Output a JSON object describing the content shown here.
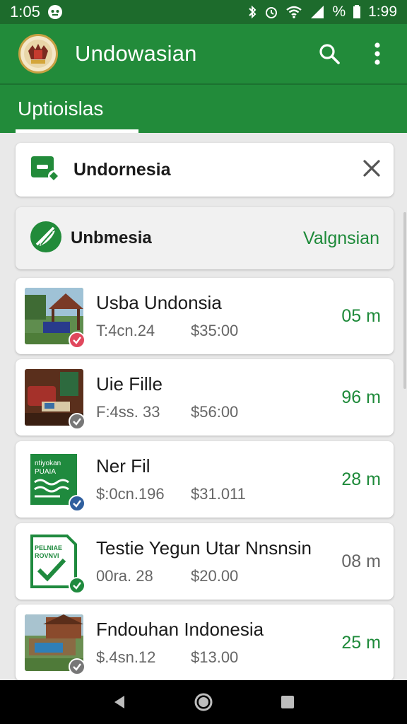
{
  "status": {
    "time": "1:05",
    "battery_pct": "%",
    "right_time": "1:99"
  },
  "app": {
    "title": "Undowasian"
  },
  "tabs": [
    {
      "label": "Uptioislas",
      "active": true
    }
  ],
  "search": {
    "label": "Undornesia"
  },
  "filter": {
    "label": "Unbmesia",
    "action": "Valgnsian"
  },
  "items": [
    {
      "title": "Usba Undonsia",
      "code": "T:4cn.24",
      "price": "$35:00",
      "distance": "05 m",
      "thumb": "pavilion",
      "badge": "red",
      "dist_color": "green"
    },
    {
      "title": "Uie Fille",
      "code": "F:4ss. 33",
      "price": "$56:00",
      "distance": "96 m",
      "thumb": "room",
      "badge": "gray",
      "dist_color": "green"
    },
    {
      "title": "Ner Fil",
      "code": "$:0cn.196",
      "price": "$31.011",
      "distance": "28 m",
      "thumb": "document",
      "badge": "blue",
      "dist_color": "green"
    },
    {
      "title": "Testie Yegun Utar Nnsnsin",
      "code": "00ra. 28",
      "price": "$20.00",
      "distance": "08 m",
      "thumb": "checklist",
      "badge": "green",
      "dist_color": "gray"
    },
    {
      "title": "Fndouhan Indonesia",
      "code": "$.4sn.12",
      "price": "$13.00",
      "distance": "25 m",
      "thumb": "house",
      "badge": "gray",
      "dist_color": "green"
    }
  ],
  "thumb_text": {
    "document": [
      "ntiyokan",
      "PUAIA"
    ],
    "checklist": [
      "PELNIAE",
      "ROVNVI"
    ]
  },
  "colors": {
    "primary": "#228b3a",
    "primary_dark": "#1d6b2c",
    "accent_text": "#1e8a3a"
  }
}
